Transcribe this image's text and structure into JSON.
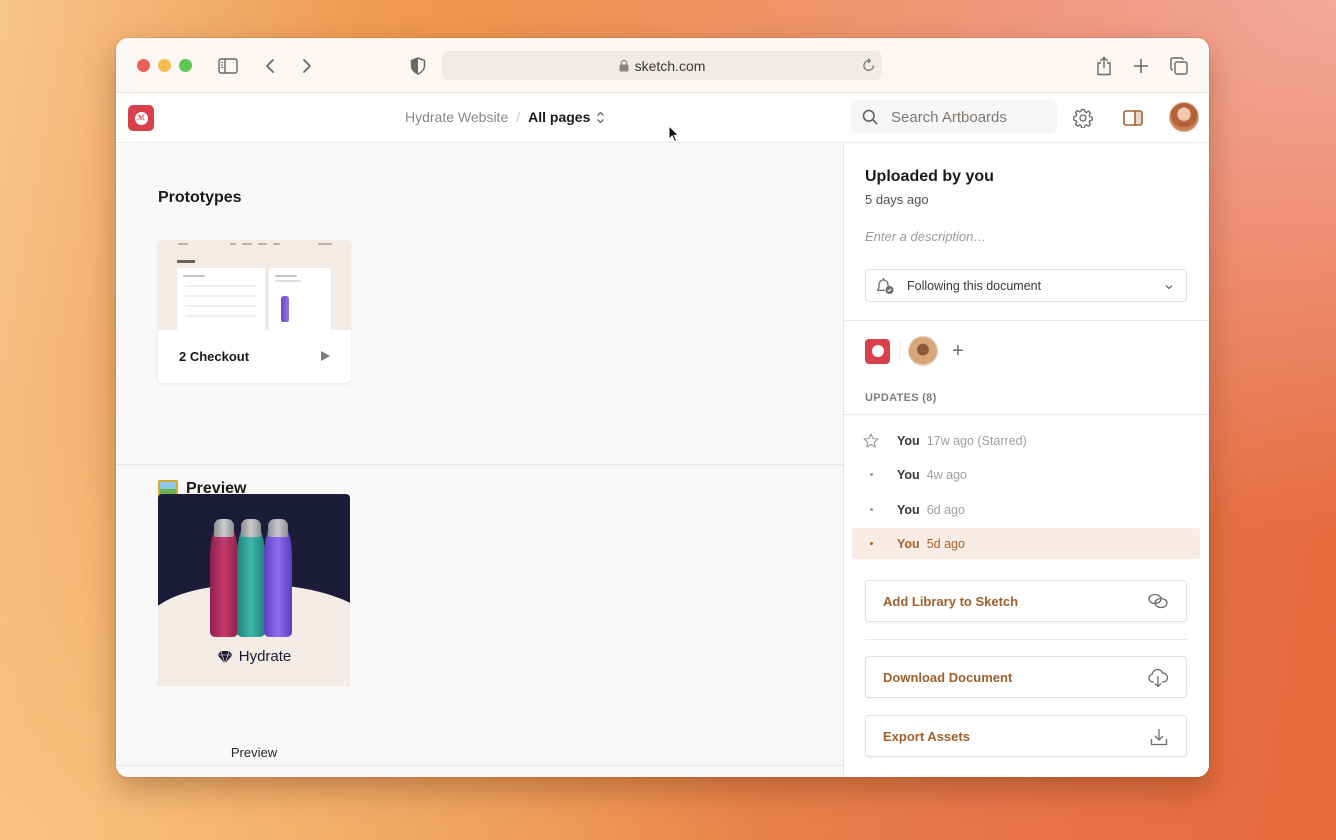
{
  "browser": {
    "url": "sketch.com",
    "icons": [
      "sidebar-toggle-icon",
      "back-icon",
      "forward-icon",
      "privacy-shield-icon",
      "lock-icon",
      "reload-icon",
      "share-icon",
      "new-tab-icon",
      "tabs-overview-icon"
    ]
  },
  "header": {
    "project": "Hydrate Website",
    "separator": "/",
    "page_selector": "All pages",
    "search_placeholder": "Search Artboards"
  },
  "main": {
    "sections": [
      {
        "title": "Prototypes",
        "items": [
          {
            "label": "2 Checkout",
            "type": "prototype"
          }
        ]
      },
      {
        "title": "Preview",
        "emoji": "framed-picture",
        "items": [
          {
            "label": "Preview",
            "brand": "Hydrate"
          }
        ]
      }
    ]
  },
  "sidebar": {
    "title": "Uploaded by you",
    "subtitle": "5 days ago",
    "description_placeholder": "Enter a description…",
    "follow_label": "Following this document",
    "updates_label": "UPDATES (8)",
    "updates": [
      {
        "who": "You",
        "when": "17w ago (Starred)",
        "marker": "star",
        "active": false
      },
      {
        "who": "You",
        "when": "4w ago",
        "marker": "dot",
        "active": false
      },
      {
        "who": "You",
        "when": "6d ago",
        "marker": "dot",
        "active": false
      },
      {
        "who": "You",
        "when": "5d ago",
        "marker": "dot",
        "active": true
      }
    ],
    "actions": [
      {
        "label": "Add Library to Sketch",
        "icon": "link-icon"
      },
      {
        "label": "Download Document",
        "icon": "cloud-download-icon"
      },
      {
        "label": "Export Assets",
        "icon": "download-icon"
      }
    ]
  },
  "colors": {
    "accent": "#a0602e",
    "brand_red": "#d9414a",
    "active_row_bg": "#f8ece5"
  }
}
